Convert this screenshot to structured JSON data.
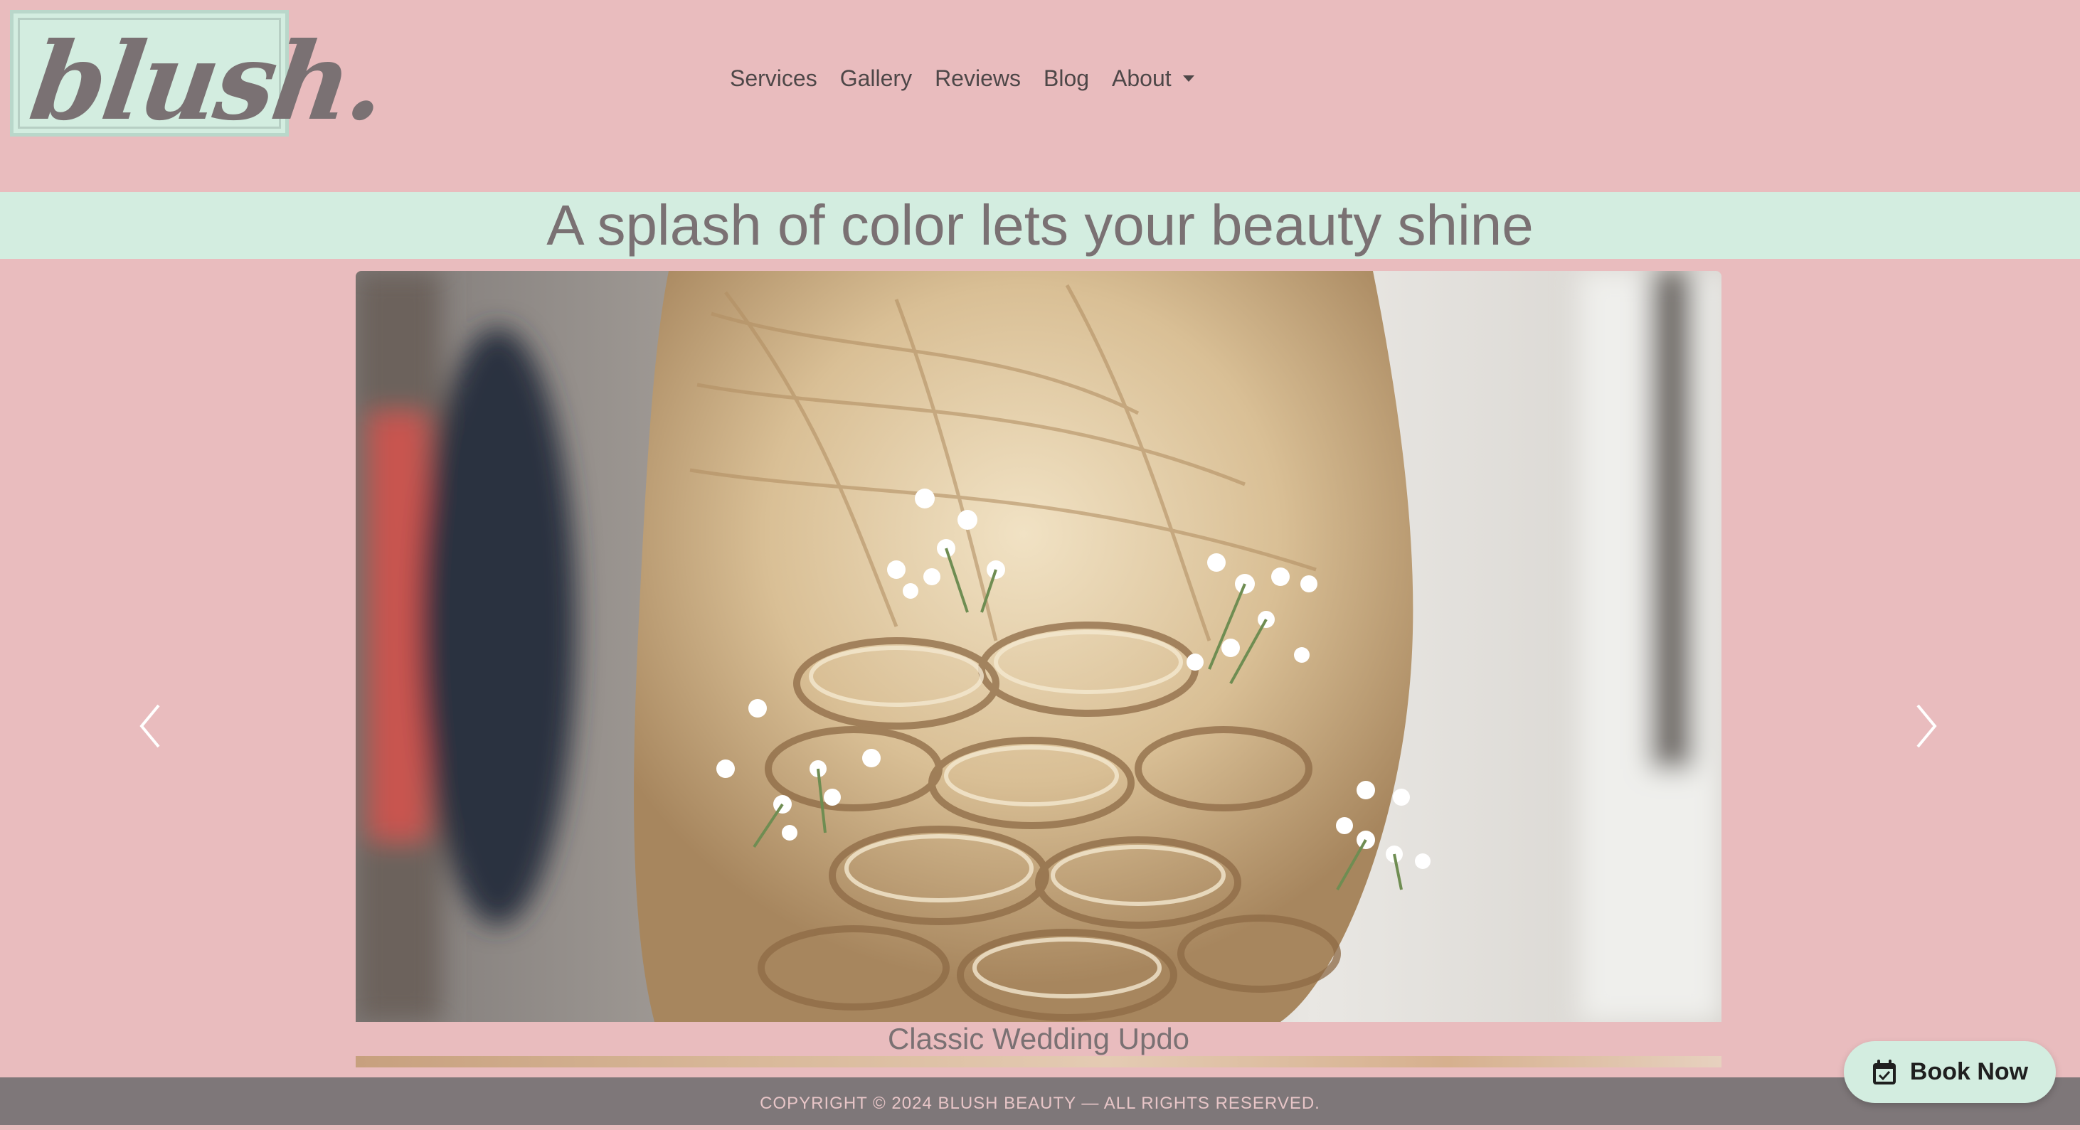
{
  "logo": {
    "text": "blush."
  },
  "nav": {
    "items": [
      {
        "label": "Services"
      },
      {
        "label": "Gallery"
      },
      {
        "label": "Reviews"
      },
      {
        "label": "Blog"
      },
      {
        "label": "About"
      }
    ]
  },
  "hero": {
    "title": "A splash of color lets your beauty shine"
  },
  "carousel": {
    "caption": "Classic Wedding Updo",
    "prev_icon": "chevron-left-icon",
    "next_icon": "chevron-right-icon"
  },
  "footer": {
    "copyright": "COPYRIGHT © 2024 BLUSH BEAUTY — ALL RIGHTS RESERVED."
  },
  "book_button": {
    "label": "Book Now",
    "icon": "calendar-check-icon"
  },
  "colors": {
    "page_bg": "#e9bcbe",
    "accent_mint": "#d3ede0",
    "text_gray": "#7a7173",
    "footer_bg": "#7e7779"
  }
}
